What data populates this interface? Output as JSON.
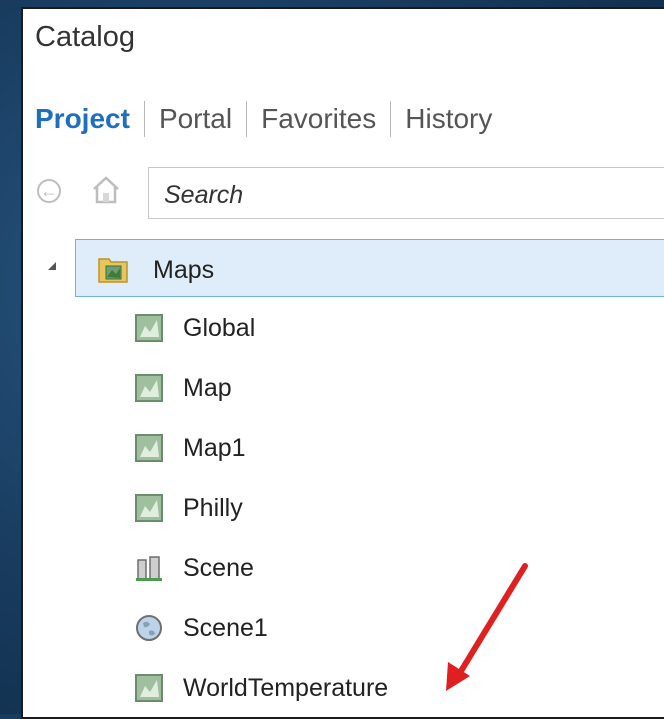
{
  "panel": {
    "title": "Catalog",
    "tabs": [
      {
        "label": "Project",
        "active": true
      },
      {
        "label": "Portal",
        "active": false
      },
      {
        "label": "Favorites",
        "active": false
      },
      {
        "label": "History",
        "active": false
      }
    ],
    "search": {
      "placeholder": "Search"
    },
    "tree": {
      "folder": {
        "label": "Maps",
        "icon": "folder-map-icon",
        "expanded": true,
        "selected": true
      },
      "items": [
        {
          "label": "Global",
          "icon": "map-icon"
        },
        {
          "label": "Map",
          "icon": "map-icon"
        },
        {
          "label": "Map1",
          "icon": "map-icon"
        },
        {
          "label": "Philly",
          "icon": "map-icon"
        },
        {
          "label": "Scene",
          "icon": "local-scene-icon"
        },
        {
          "label": "Scene1",
          "icon": "global-scene-icon"
        },
        {
          "label": "WorldTemperature",
          "icon": "map-icon"
        }
      ]
    }
  },
  "annotation": {
    "color": "#e02020",
    "points_to": "WorldTemperature"
  },
  "colors": {
    "accent": "#1e6fc0",
    "selection_bg": "#deedf9",
    "selection_border": "#6fb0e8",
    "background": "#1b4a74"
  }
}
